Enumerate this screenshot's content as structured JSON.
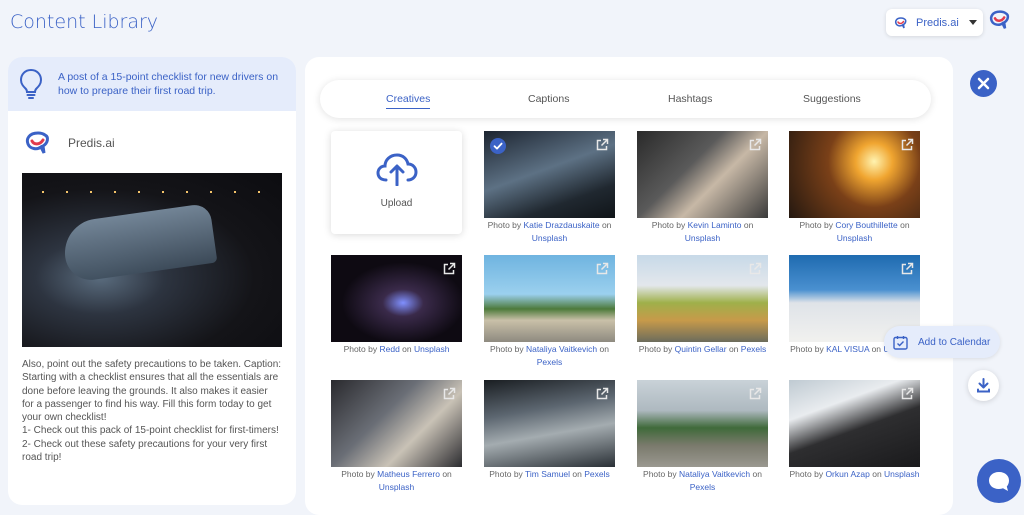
{
  "header": {
    "title": "Content Library",
    "brand_select": "Predis.ai"
  },
  "sidebar": {
    "prompt": "A post of a 15-point checklist for new drivers on how to prepare their first road trip.",
    "brand_name": "Predis.ai",
    "post_text": "Also, point out the safety precautions to be taken. Caption: Starting with a checklist ensures that all the essentials are done before leaving the grounds. It also makes it easier for a passenger to find his way. Fill this form today to get your own checklist!\n1- Check out this pack of 15-point checklist for first-timers!\n2- Check out these safety precautions for your very first road trip!"
  },
  "tabs": [
    "Creatives",
    "Captions",
    "Hashtags",
    "Suggestions"
  ],
  "upload_label": "Upload",
  "photos": [
    {
      "prefix": "Photo by ",
      "author": "Katie Drazdauskaite",
      "mid": " on ",
      "source": "Unsplash",
      "selected": true
    },
    {
      "prefix": "Photo by ",
      "author": "Kevin Laminto",
      "mid": " on ",
      "source": "Unsplash"
    },
    {
      "prefix": "Photo by ",
      "author": "Cory Bouthillette",
      "mid": " on ",
      "source": "Unsplash"
    },
    {
      "prefix": "Photo by ",
      "author": "Redd",
      "mid": " on ",
      "source": "Unsplash"
    },
    {
      "prefix": "Photo by ",
      "author": "Nataliya Vaitkevich",
      "mid": " on ",
      "source": "Pexels"
    },
    {
      "prefix": "Photo by ",
      "author": "Quintin Gellar",
      "mid": " on ",
      "source": "Pexels"
    },
    {
      "prefix": "Photo by ",
      "author": "KAL VISUA",
      "mid": " on ",
      "source": "Unsplash"
    },
    {
      "prefix": "Photo by ",
      "author": "Matheus Ferrero",
      "mid": " on ",
      "source": "Unsplash"
    },
    {
      "prefix": "Photo by ",
      "author": "Tim Samuel",
      "mid": " on ",
      "source": "Pexels"
    },
    {
      "prefix": "Photo by ",
      "author": "Nataliya Vaitkevich",
      "mid": " on ",
      "source": "Pexels"
    },
    {
      "prefix": "Photo by ",
      "author": "Orkun Azap",
      "mid": " on ",
      "source": "Unsplash"
    }
  ],
  "actions": {
    "add_to_calendar": "Add to Calendar"
  },
  "icons": {
    "brand": "predis-logo",
    "prompt": "lightbulb-icon",
    "upload": "cloud-upload-icon",
    "open": "external-link-icon",
    "selected": "check-icon",
    "close": "close-icon",
    "calendar": "calendar-check-icon",
    "download": "download-icon",
    "chat": "chat-icon"
  },
  "colors": {
    "accent": "#3b62c6",
    "panel_tint": "#e5ecfb",
    "background": "#f1f4fa"
  }
}
